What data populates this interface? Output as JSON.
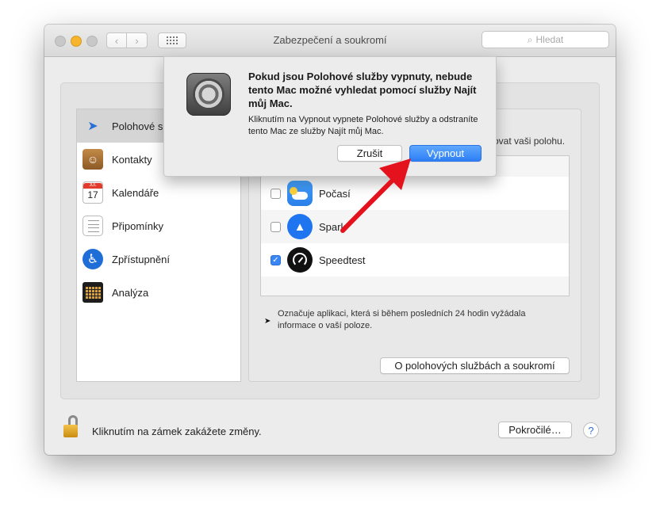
{
  "window": {
    "title": "Zabezpečení a soukromí",
    "search_placeholder": "Hledat"
  },
  "sidebar": {
    "items": [
      {
        "label": "Polohové s",
        "icon": "location-arrow-icon",
        "selected": true
      },
      {
        "label": "Kontakty",
        "icon": "contacts-book-icon"
      },
      {
        "label": "Kalendáře",
        "icon": "calendar-icon",
        "cal_month": "JUL",
        "cal_day": "17"
      },
      {
        "label": "Připomínky",
        "icon": "reminders-icon"
      },
      {
        "label": "Zpřístupnění",
        "icon": "accessibility-icon"
      },
      {
        "label": "Analýza",
        "icon": "analytics-icon"
      }
    ]
  },
  "panel": {
    "partial_text": "ovat vaši polohu.",
    "apps": [
      {
        "name": "Počasí",
        "checked": false,
        "icon": "weather-icon"
      },
      {
        "name": "Spark",
        "checked": false,
        "icon": "spark-icon"
      },
      {
        "name": "Speedtest",
        "checked": true,
        "icon": "speedtest-icon"
      }
    ],
    "note": "Označuje aplikaci, která si během posledních 24 hodin vyžádala informace o vaší poloze.",
    "about_button": "O polohových službách a soukromí"
  },
  "footer": {
    "lock_text": "Kliknutím na zámek zakážete změny.",
    "advanced_button": "Pokročilé…",
    "help": "?"
  },
  "dialog": {
    "title": "Pokud jsou Polohové služby vypnuty, nebude tento Mac možné vyhledat pomocí služby Najít můj Mac.",
    "body": "Kliknutím na Vypnout vypnete Polohové služby a odstraníte tento Mac ze služby Najít můj Mac.",
    "cancel_button": "Zrušit",
    "off_button": "Vypnout"
  },
  "colors": {
    "accent": "#2e7ff6",
    "annotation_arrow": "#e3121c"
  }
}
